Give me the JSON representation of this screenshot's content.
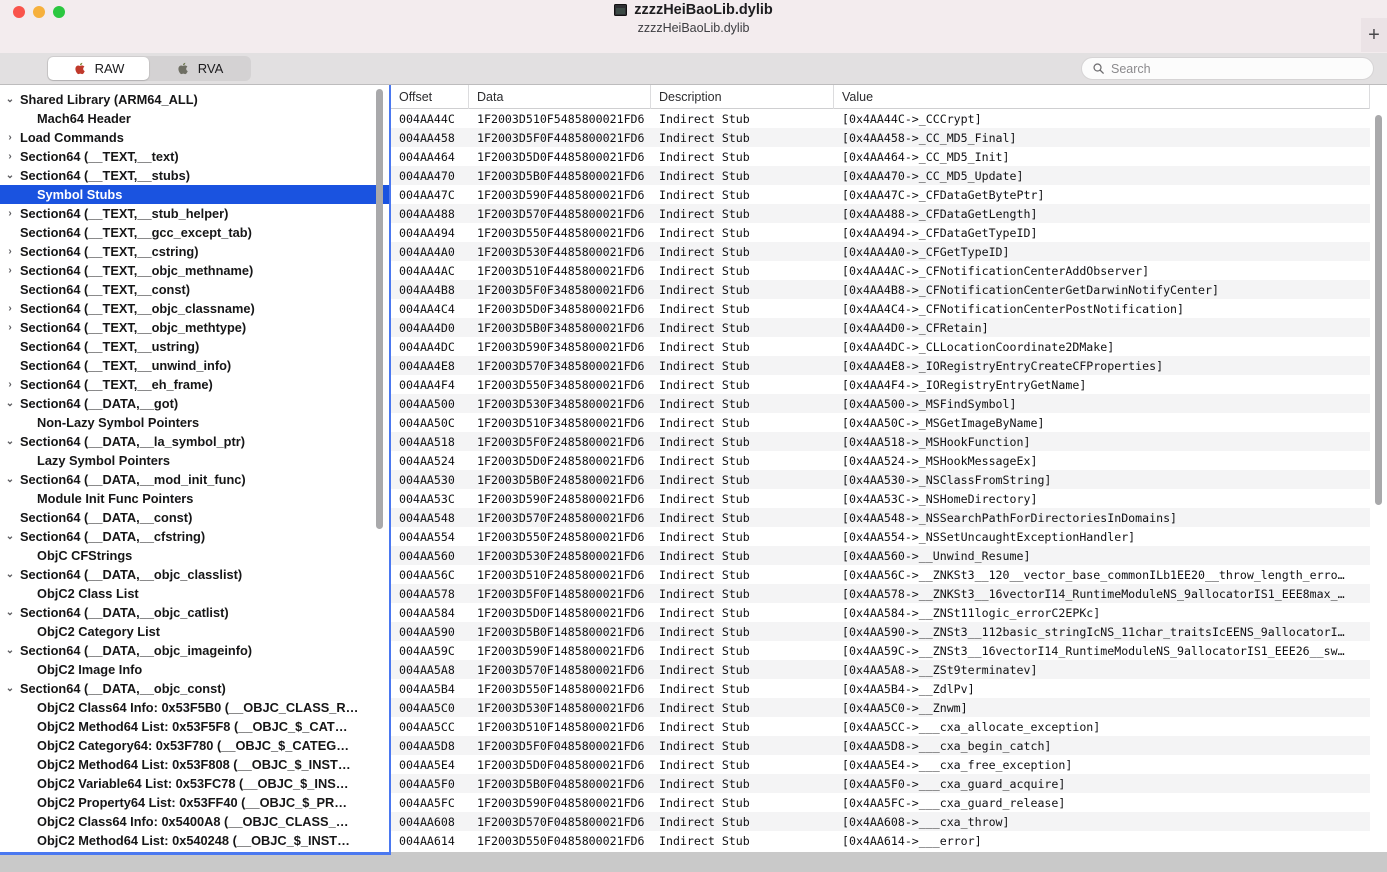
{
  "window": {
    "title": "zzzzHeiBaoLib.dylib",
    "subtitle": "zzzzHeiBaoLib.dylib",
    "doc_icon": "document-icon",
    "traffic_lights": [
      "close-button",
      "minimize-button",
      "zoom-button"
    ],
    "add_tab_label": "+",
    "accent_color": "#1a53e0",
    "focus_border_color": "#4a78f0"
  },
  "toolbar": {
    "segments": [
      {
        "label": "RAW",
        "icon": "apple-logo-icon",
        "active": true
      },
      {
        "label": "RVA",
        "icon": "apple-logo-icon",
        "active": false
      }
    ],
    "search": {
      "icon": "search-icon",
      "placeholder": "Search",
      "value": ""
    }
  },
  "sidebar": {
    "scrollbar": "sidebar-scrollbar",
    "items": [
      {
        "label": "Shared Library  (ARM64_ALL)",
        "depth": 0,
        "twisty": "down",
        "selected": false
      },
      {
        "label": "Mach64 Header",
        "depth": 1,
        "twisty": "none",
        "selected": false
      },
      {
        "label": "Load Commands",
        "depth": 0,
        "twisty": "right",
        "selected": false
      },
      {
        "label": "Section64 (__TEXT,__text)",
        "depth": 0,
        "twisty": "right",
        "selected": false
      },
      {
        "label": "Section64 (__TEXT,__stubs)",
        "depth": 0,
        "twisty": "down",
        "selected": false
      },
      {
        "label": "Symbol Stubs",
        "depth": 1,
        "twisty": "none",
        "selected": true
      },
      {
        "label": "Section64 (__TEXT,__stub_helper)",
        "depth": 0,
        "twisty": "right",
        "selected": false
      },
      {
        "label": "Section64 (__TEXT,__gcc_except_tab)",
        "depth": 0,
        "twisty": "none",
        "selected": false
      },
      {
        "label": "Section64 (__TEXT,__cstring)",
        "depth": 0,
        "twisty": "right",
        "selected": false
      },
      {
        "label": "Section64 (__TEXT,__objc_methname)",
        "depth": 0,
        "twisty": "right",
        "selected": false
      },
      {
        "label": "Section64 (__TEXT,__const)",
        "depth": 0,
        "twisty": "none",
        "selected": false
      },
      {
        "label": "Section64 (__TEXT,__objc_classname)",
        "depth": 0,
        "twisty": "right",
        "selected": false
      },
      {
        "label": "Section64 (__TEXT,__objc_methtype)",
        "depth": 0,
        "twisty": "right",
        "selected": false
      },
      {
        "label": "Section64 (__TEXT,__ustring)",
        "depth": 0,
        "twisty": "none",
        "selected": false
      },
      {
        "label": "Section64 (__TEXT,__unwind_info)",
        "depth": 0,
        "twisty": "none",
        "selected": false
      },
      {
        "label": "Section64 (__TEXT,__eh_frame)",
        "depth": 0,
        "twisty": "right",
        "selected": false
      },
      {
        "label": "Section64 (__DATA,__got)",
        "depth": 0,
        "twisty": "down",
        "selected": false
      },
      {
        "label": "Non-Lazy Symbol Pointers",
        "depth": 1,
        "twisty": "none",
        "selected": false
      },
      {
        "label": "Section64 (__DATA,__la_symbol_ptr)",
        "depth": 0,
        "twisty": "down",
        "selected": false
      },
      {
        "label": "Lazy Symbol Pointers",
        "depth": 1,
        "twisty": "none",
        "selected": false
      },
      {
        "label": "Section64 (__DATA,__mod_init_func)",
        "depth": 0,
        "twisty": "down",
        "selected": false
      },
      {
        "label": "Module Init Func Pointers",
        "depth": 1,
        "twisty": "none",
        "selected": false
      },
      {
        "label": "Section64 (__DATA,__const)",
        "depth": 0,
        "twisty": "none",
        "selected": false
      },
      {
        "label": "Section64 (__DATA,__cfstring)",
        "depth": 0,
        "twisty": "down",
        "selected": false
      },
      {
        "label": "ObjC CFStrings",
        "depth": 1,
        "twisty": "none",
        "selected": false
      },
      {
        "label": "Section64 (__DATA,__objc_classlist)",
        "depth": 0,
        "twisty": "down",
        "selected": false
      },
      {
        "label": "ObjC2 Class List",
        "depth": 1,
        "twisty": "none",
        "selected": false
      },
      {
        "label": "Section64 (__DATA,__objc_catlist)",
        "depth": 0,
        "twisty": "down",
        "selected": false
      },
      {
        "label": "ObjC2 Category List",
        "depth": 1,
        "twisty": "none",
        "selected": false
      },
      {
        "label": "Section64 (__DATA,__objc_imageinfo)",
        "depth": 0,
        "twisty": "down",
        "selected": false
      },
      {
        "label": "ObjC2 Image Info",
        "depth": 1,
        "twisty": "none",
        "selected": false
      },
      {
        "label": "Section64 (__DATA,__objc_const)",
        "depth": 0,
        "twisty": "down",
        "selected": false
      },
      {
        "label": "ObjC2 Class64 Info: 0x53F5B0 (__OBJC_CLASS_R…",
        "depth": 1,
        "twisty": "none",
        "selected": false
      },
      {
        "label": "ObjC2 Method64 List: 0x53F5F8 (__OBJC_$_CAT…",
        "depth": 1,
        "twisty": "none",
        "selected": false
      },
      {
        "label": "ObjC2 Category64: 0x53F780 (__OBJC_$_CATEG…",
        "depth": 1,
        "twisty": "none",
        "selected": false
      },
      {
        "label": "ObjC2 Method64 List: 0x53F808 (__OBJC_$_INST…",
        "depth": 1,
        "twisty": "none",
        "selected": false
      },
      {
        "label": "ObjC2 Variable64 List: 0x53FC78 (__OBJC_$_INS…",
        "depth": 1,
        "twisty": "none",
        "selected": false
      },
      {
        "label": "ObjC2 Property64 List: 0x53FF40 (__OBJC_$_PR…",
        "depth": 1,
        "twisty": "none",
        "selected": false
      },
      {
        "label": "ObjC2 Class64 Info: 0x5400A8 (__OBJC_CLASS_…",
        "depth": 1,
        "twisty": "none",
        "selected": false
      },
      {
        "label": "ObjC2 Method64 List: 0x540248 (__OBJC_$_INST…",
        "depth": 1,
        "twisty": "none",
        "selected": false
      }
    ]
  },
  "table": {
    "columns": [
      "Offset",
      "Data",
      "Description",
      "Value"
    ],
    "scrollbar": "table-scrollbar",
    "rows": [
      [
        "004AA44C",
        "1F2003D510F5485800021FD6",
        "Indirect Stub",
        "[0x4AA44C->_CCCrypt]"
      ],
      [
        "004AA458",
        "1F2003D5F0F4485800021FD6",
        "Indirect Stub",
        "[0x4AA458->_CC_MD5_Final]"
      ],
      [
        "004AA464",
        "1F2003D5D0F4485800021FD6",
        "Indirect Stub",
        "[0x4AA464->_CC_MD5_Init]"
      ],
      [
        "004AA470",
        "1F2003D5B0F4485800021FD6",
        "Indirect Stub",
        "[0x4AA470->_CC_MD5_Update]"
      ],
      [
        "004AA47C",
        "1F2003D590F4485800021FD6",
        "Indirect Stub",
        "[0x4AA47C->_CFDataGetBytePtr]"
      ],
      [
        "004AA488",
        "1F2003D570F4485800021FD6",
        "Indirect Stub",
        "[0x4AA488->_CFDataGetLength]"
      ],
      [
        "004AA494",
        "1F2003D550F4485800021FD6",
        "Indirect Stub",
        "[0x4AA494->_CFDataGetTypeID]"
      ],
      [
        "004AA4A0",
        "1F2003D530F4485800021FD6",
        "Indirect Stub",
        "[0x4AA4A0->_CFGetTypeID]"
      ],
      [
        "004AA4AC",
        "1F2003D510F4485800021FD6",
        "Indirect Stub",
        "[0x4AA4AC->_CFNotificationCenterAddObserver]"
      ],
      [
        "004AA4B8",
        "1F2003D5F0F3485800021FD6",
        "Indirect Stub",
        "[0x4AA4B8->_CFNotificationCenterGetDarwinNotifyCenter]"
      ],
      [
        "004AA4C4",
        "1F2003D5D0F3485800021FD6",
        "Indirect Stub",
        "[0x4AA4C4->_CFNotificationCenterPostNotification]"
      ],
      [
        "004AA4D0",
        "1F2003D5B0F3485800021FD6",
        "Indirect Stub",
        "[0x4AA4D0->_CFRetain]"
      ],
      [
        "004AA4DC",
        "1F2003D590F3485800021FD6",
        "Indirect Stub",
        "[0x4AA4DC->_CLLocationCoordinate2DMake]"
      ],
      [
        "004AA4E8",
        "1F2003D570F3485800021FD6",
        "Indirect Stub",
        "[0x4AA4E8->_IORegistryEntryCreateCFProperties]"
      ],
      [
        "004AA4F4",
        "1F2003D550F3485800021FD6",
        "Indirect Stub",
        "[0x4AA4F4->_IORegistryEntryGetName]"
      ],
      [
        "004AA500",
        "1F2003D530F3485800021FD6",
        "Indirect Stub",
        "[0x4AA500->_MSFindSymbol]"
      ],
      [
        "004AA50C",
        "1F2003D510F3485800021FD6",
        "Indirect Stub",
        "[0x4AA50C->_MSGetImageByName]"
      ],
      [
        "004AA518",
        "1F2003D5F0F2485800021FD6",
        "Indirect Stub",
        "[0x4AA518->_MSHookFunction]"
      ],
      [
        "004AA524",
        "1F2003D5D0F2485800021FD6",
        "Indirect Stub",
        "[0x4AA524->_MSHookMessageEx]"
      ],
      [
        "004AA530",
        "1F2003D5B0F2485800021FD6",
        "Indirect Stub",
        "[0x4AA530->_NSClassFromString]"
      ],
      [
        "004AA53C",
        "1F2003D590F2485800021FD6",
        "Indirect Stub",
        "[0x4AA53C->_NSHomeDirectory]"
      ],
      [
        "004AA548",
        "1F2003D570F2485800021FD6",
        "Indirect Stub",
        "[0x4AA548->_NSSearchPathForDirectoriesInDomains]"
      ],
      [
        "004AA554",
        "1F2003D550F2485800021FD6",
        "Indirect Stub",
        "[0x4AA554->_NSSetUncaughtExceptionHandler]"
      ],
      [
        "004AA560",
        "1F2003D530F2485800021FD6",
        "Indirect Stub",
        "[0x4AA560->__Unwind_Resume]"
      ],
      [
        "004AA56C",
        "1F2003D510F2485800021FD6",
        "Indirect Stub",
        "[0x4AA56C->__ZNKSt3__120__vector_base_commonILb1EE20__throw_length_erro…"
      ],
      [
        "004AA578",
        "1F2003D5F0F1485800021FD6",
        "Indirect Stub",
        "[0x4AA578->__ZNKSt3__16vectorI14_RuntimeModuleNS_9allocatorIS1_EEE8max_…"
      ],
      [
        "004AA584",
        "1F2003D5D0F1485800021FD6",
        "Indirect Stub",
        "[0x4AA584->__ZNSt11logic_errorC2EPKc]"
      ],
      [
        "004AA590",
        "1F2003D5B0F1485800021FD6",
        "Indirect Stub",
        "[0x4AA590->__ZNSt3__112basic_stringIcNS_11char_traitsIcEENS_9allocatorI…"
      ],
      [
        "004AA59C",
        "1F2003D590F1485800021FD6",
        "Indirect Stub",
        "[0x4AA59C->__ZNSt3__16vectorI14_RuntimeModuleNS_9allocatorIS1_EEE26__sw…"
      ],
      [
        "004AA5A8",
        "1F2003D570F1485800021FD6",
        "Indirect Stub",
        "[0x4AA5A8->__ZSt9terminatev]"
      ],
      [
        "004AA5B4",
        "1F2003D550F1485800021FD6",
        "Indirect Stub",
        "[0x4AA5B4->__ZdlPv]"
      ],
      [
        "004AA5C0",
        "1F2003D530F1485800021FD6",
        "Indirect Stub",
        "[0x4AA5C0->__Znwm]"
      ],
      [
        "004AA5CC",
        "1F2003D510F1485800021FD6",
        "Indirect Stub",
        "[0x4AA5CC->___cxa_allocate_exception]"
      ],
      [
        "004AA5D8",
        "1F2003D5F0F0485800021FD6",
        "Indirect Stub",
        "[0x4AA5D8->___cxa_begin_catch]"
      ],
      [
        "004AA5E4",
        "1F2003D5D0F0485800021FD6",
        "Indirect Stub",
        "[0x4AA5E4->___cxa_free_exception]"
      ],
      [
        "004AA5F0",
        "1F2003D5B0F0485800021FD6",
        "Indirect Stub",
        "[0x4AA5F0->___cxa_guard_acquire]"
      ],
      [
        "004AA5FC",
        "1F2003D590F0485800021FD6",
        "Indirect Stub",
        "[0x4AA5FC->___cxa_guard_release]"
      ],
      [
        "004AA608",
        "1F2003D570F0485800021FD6",
        "Indirect Stub",
        "[0x4AA608->___cxa_throw]"
      ],
      [
        "004AA614",
        "1F2003D550F0485800021FD6",
        "Indirect Stub",
        "[0x4AA614->___error]"
      ]
    ]
  }
}
